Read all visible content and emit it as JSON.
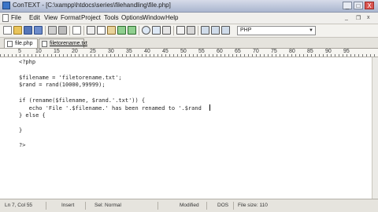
{
  "window": {
    "title": "ConTEXT - [C:\\xampp\\htdocs\\series\\filehandling\\file.php]",
    "buttons": {
      "minimize": "_",
      "maximize": "□",
      "close": "X"
    }
  },
  "menu": {
    "items": [
      "File",
      "Edit",
      "View",
      "Format",
      "Project",
      "Tools",
      "Options",
      "Window",
      "Help"
    ],
    "controls": {
      "min": "_",
      "restore": "❐",
      "close": "x"
    }
  },
  "toolbar": {
    "language": "PHP",
    "icons": [
      "new-file-icon",
      "open-icon",
      "save-icon",
      "save-all-icon",
      "print-icon",
      "cut-icon",
      "copy-icon",
      "paste-icon",
      "undo-icon",
      "redo-icon",
      "find-icon",
      "replace-icon",
      "find-next-icon",
      "goto-icon",
      "settings-icon",
      "run-icon",
      "user-command-1-icon",
      "user-command-2-icon",
      "user-command-3-icon"
    ]
  },
  "tabs": [
    {
      "label": "file.php",
      "active": true
    },
    {
      "label": "filetorename.txt",
      "active": false
    }
  ],
  "ruler": {
    "labels": [
      "5",
      "10",
      "15",
      "20",
      "25",
      "30",
      "35",
      "40",
      "45",
      "50",
      "55",
      "60",
      "65",
      "70",
      "75",
      "80",
      "85",
      "90",
      "95"
    ]
  },
  "editor": {
    "lines": [
      "<?php",
      "",
      "$filename = 'filetorename.txt';",
      "$rand = rand(10000,99999);",
      "",
      "if (rename($filename, $rand.'.txt')) {",
      "   echo 'File '.$filename.' has been renamed to '.$rand",
      "} else {",
      "",
      "}",
      "",
      "?>"
    ]
  },
  "status": {
    "position": "Ln 7, Col 55",
    "mode": "Insert",
    "selection": "Sel: Normal",
    "state": "Modified",
    "format": "DOS",
    "size": "File size: 110"
  }
}
